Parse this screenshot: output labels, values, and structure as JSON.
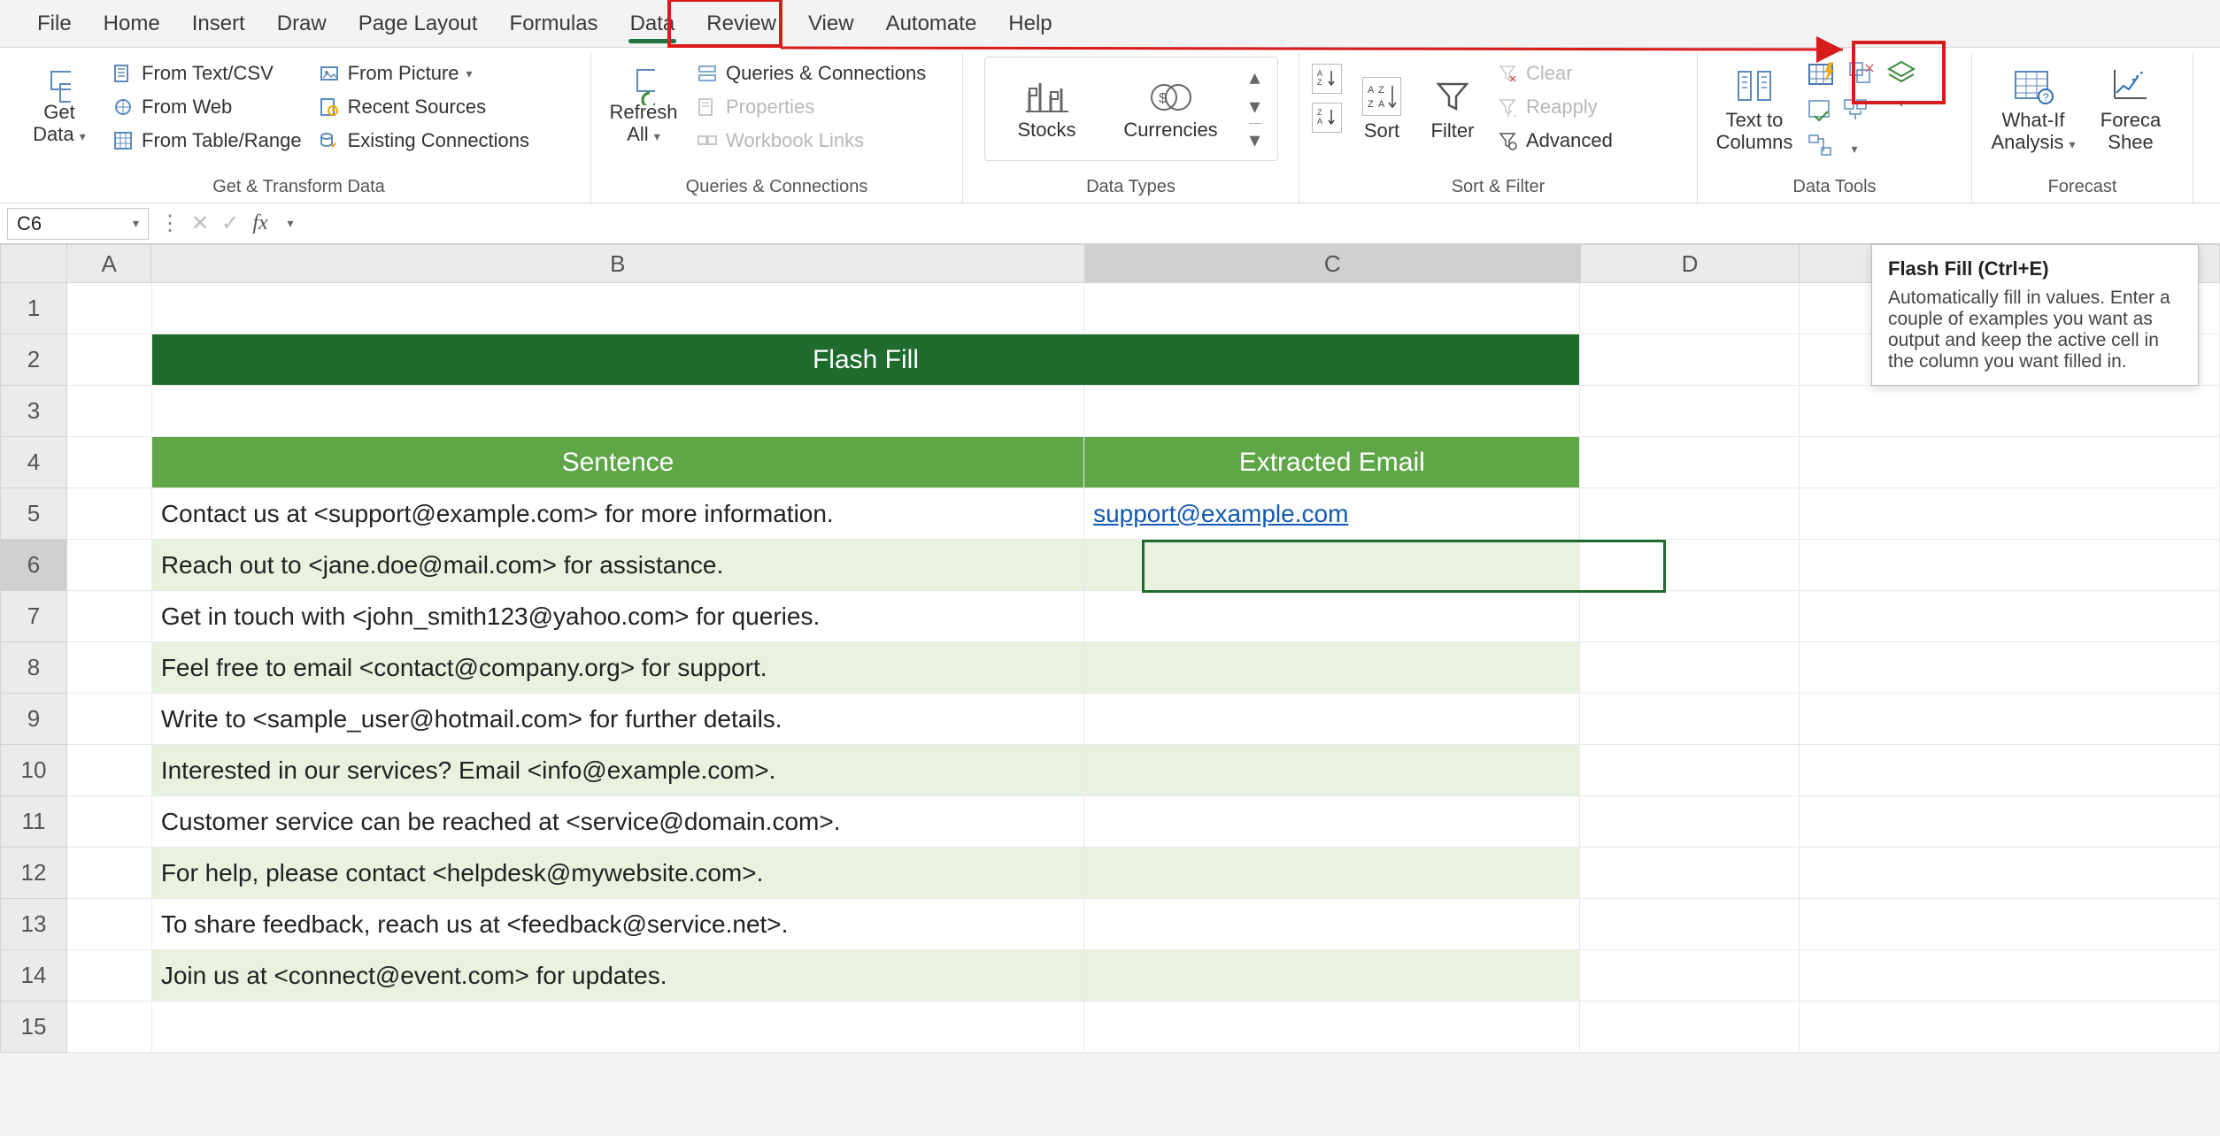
{
  "tabs": {
    "file": "File",
    "home": "Home",
    "insert": "Insert",
    "draw": "Draw",
    "page_layout": "Page Layout",
    "formulas": "Formulas",
    "data": "Data",
    "review": "Review",
    "view": "View",
    "automate": "Automate",
    "help": "Help",
    "active": "Data"
  },
  "ribbon": {
    "get_transform": {
      "label": "Get & Transform Data",
      "get_data": "Get\nData",
      "from_text": "From Text/CSV",
      "from_web": "From Web",
      "from_table": "From Table/Range",
      "from_picture": "From Picture",
      "recent": "Recent Sources",
      "existing": "Existing Connections"
    },
    "queries": {
      "label": "Queries & Connections",
      "refresh": "Refresh\nAll",
      "qc": "Queries & Connections",
      "props": "Properties",
      "links": "Workbook Links"
    },
    "data_types": {
      "label": "Data Types",
      "stocks": "Stocks",
      "currencies": "Currencies"
    },
    "sort_filter": {
      "label": "Sort & Filter",
      "sort": "Sort",
      "filter": "Filter",
      "clear": "Clear",
      "reapply": "Reapply",
      "advanced": "Advanced"
    },
    "data_tools": {
      "label": "Data Tools",
      "text_to_columns": "Text to\nColumns"
    },
    "forecast": {
      "label": "Forecast",
      "whatif": "What-If\nAnalysis",
      "sheet": "Foreca\nShee"
    }
  },
  "tooltip": {
    "title": "Flash Fill (Ctrl+E)",
    "body": "Automatically fill in values. Enter a couple of examples you want as output and keep the active cell in the column you want filled in."
  },
  "formula_bar": {
    "name_box": "C6",
    "formula": ""
  },
  "columns": [
    "A",
    "B",
    "C",
    "D"
  ],
  "row_numbers": [
    "1",
    "2",
    "3",
    "4",
    "5",
    "6",
    "7",
    "8",
    "9",
    "10",
    "11",
    "12",
    "13",
    "14",
    "15"
  ],
  "sheet": {
    "banner": "Flash Fill",
    "col_b_header": "Sentence",
    "col_c_header": "Extracted Email",
    "rows": [
      {
        "b": "Contact us at <support@example.com> for more information.",
        "c": "support@example.com",
        "alt": false,
        "link": true
      },
      {
        "b": "Reach out to <jane.doe@mail.com> for assistance.",
        "c": "",
        "alt": true
      },
      {
        "b": "Get in touch with <john_smith123@yahoo.com> for queries.",
        "c": "",
        "alt": false
      },
      {
        "b": "Feel free to email <contact@company.org> for support.",
        "c": "",
        "alt": true
      },
      {
        "b": "Write to <sample_user@hotmail.com> for further details.",
        "c": "",
        "alt": false
      },
      {
        "b": "Interested in our services? Email <info@example.com>.",
        "c": "",
        "alt": true
      },
      {
        "b": "Customer service can be reached at <service@domain.com>.",
        "c": "",
        "alt": false
      },
      {
        "b": "For help, please contact <helpdesk@mywebsite.com>.",
        "c": "",
        "alt": true
      },
      {
        "b": "To share feedback, reach us at <feedback@service.net>.",
        "c": "",
        "alt": false
      },
      {
        "b": "Join us at <connect@event.com> for updates.",
        "c": "",
        "alt": true
      }
    ]
  },
  "active_cell": "C6"
}
